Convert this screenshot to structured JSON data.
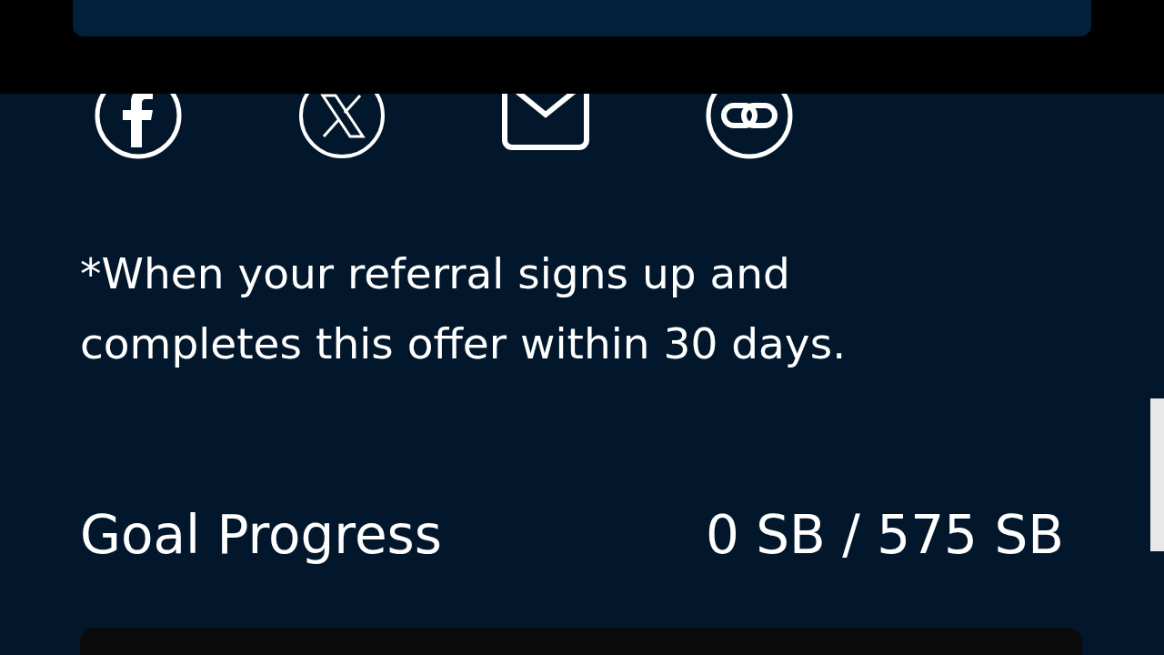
{
  "footnote": "*When your referral signs up and completes this offer within 30 days.",
  "goal_progress": {
    "label": "Goal Progress",
    "value": "0 SB / 575 SB"
  }
}
